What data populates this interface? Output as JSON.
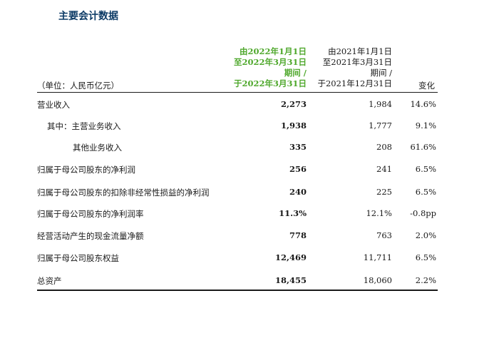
{
  "title": "主要会计数据",
  "header": {
    "unit": "（单位：人民币亿元）",
    "current_lines": [
      "由2022年1月1日",
      "至2022年3月31日",
      "期间 /",
      "于2022年3月31日"
    ],
    "previous_lines": [
      "由2021年1月1日",
      "至2021年3月31日",
      "期间 /",
      "于2021年12月31日"
    ],
    "change": "变化"
  },
  "rows": [
    {
      "label": "营业收入",
      "indent": 0,
      "current": "2,273",
      "previous": "1,984",
      "change": "14.6%"
    },
    {
      "label": "其中：主营业务收入",
      "indent": 1,
      "current": "1,938",
      "previous": "1,777",
      "change": "9.1%"
    },
    {
      "label": "其他业务收入",
      "indent": 2,
      "current": "335",
      "previous": "208",
      "change": "61.6%"
    },
    {
      "label": "归属于母公司股东的净利润",
      "indent": 0,
      "current": "256",
      "previous": "241",
      "change": "6.5%"
    },
    {
      "label": "归属于母公司股东的扣除非经常性损益的净利润",
      "indent": 0,
      "current": "240",
      "previous": "225",
      "change": "6.5%"
    },
    {
      "label": "归属于母公司股东的净利润率",
      "indent": 0,
      "current": "11.3%",
      "previous": "12.1%",
      "change": "-0.8pp"
    },
    {
      "label": "经营活动产生的现金流量净额",
      "indent": 0,
      "current": "778",
      "previous": "763",
      "change": "2.0%"
    },
    {
      "label": "归属于母公司股东权益",
      "indent": 0,
      "current": "12,469",
      "previous": "11,711",
      "change": "6.5%"
    },
    {
      "label": "总资产",
      "indent": 0,
      "current": "18,455",
      "previous": "18,060",
      "change": "2.2%"
    }
  ]
}
